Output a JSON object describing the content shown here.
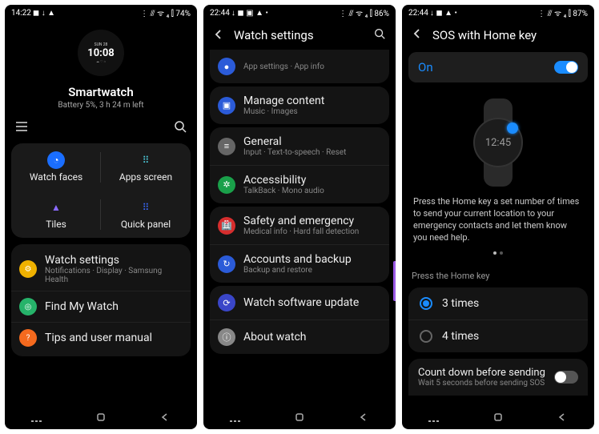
{
  "phone1": {
    "status": {
      "time": "14:22",
      "left_icons": "◼ ↓ ▲",
      "right_icons": "⋮ ⫻ ᯤ ₄ ⫿ 74%"
    },
    "watchface": {
      "date": "SUN 28",
      "time": "10:08",
      "extras": "☁ ♡ ⌂"
    },
    "device_name": "Smartwatch",
    "device_sub": "Battery 5%, 3 h 24 m left",
    "grid": [
      {
        "label": "Watch faces",
        "icon": "◔",
        "bg": "#1a6eff"
      },
      {
        "label": "Apps screen",
        "icon": "⠿",
        "bg": "#000"
      },
      {
        "label": "Tiles",
        "icon": "▲",
        "bg": "#000"
      },
      {
        "label": "Quick panel",
        "icon": "⠿",
        "bg": "#3a3ad6"
      }
    ],
    "settings": [
      {
        "title": "Watch settings",
        "sub": "Notifications · Display · Samsung Health",
        "bg": "#efb100",
        "icon": "⚙"
      },
      {
        "title": "Find My Watch",
        "sub": "",
        "bg": "#26b36a",
        "icon": "◎"
      },
      {
        "title": "Tips and user manual",
        "sub": "",
        "bg": "#f56a1e",
        "icon": "?"
      }
    ]
  },
  "phone2": {
    "status": {
      "time": "22:44",
      "left_icons": "↓ ◼ ▣ ▲ •",
      "right_icons": "⋮ ⫻ ᯤ ₄ ⫿ 86%"
    },
    "header": "Watch settings",
    "groups": [
      [
        {
          "title": "",
          "sub": "App settings · App info",
          "bg": "#2b5bd8",
          "icon": "●"
        }
      ],
      [
        {
          "title": "Manage content",
          "sub": "Music · Images",
          "bg": "#2b5bd8",
          "icon": "▣"
        }
      ],
      [
        {
          "title": "General",
          "sub": "Input · Text-to-speech · Reset",
          "bg": "#666",
          "icon": "≡"
        },
        {
          "title": "Accessibility",
          "sub": "TalkBack · Mono audio",
          "bg": "#1aa04a",
          "icon": "✲"
        }
      ],
      [
        {
          "title": "Safety and emergency",
          "sub": "Medical info · Hard fall detection",
          "bg": "#d62e2e",
          "icon": "🏥"
        },
        {
          "title": "Accounts and backup",
          "sub": "Backup and restore",
          "bg": "#2b5bd8",
          "icon": "↻"
        }
      ],
      [
        {
          "title": "Watch software update",
          "sub": "",
          "bg": "#3a46c8",
          "icon": "⟳"
        },
        {
          "title": "About watch",
          "sub": "",
          "bg": "#888",
          "icon": "ⓘ"
        }
      ]
    ]
  },
  "phone3": {
    "status": {
      "time": "22:44",
      "left_icons": "↓ ◼ ▲ •",
      "right_icons": "⋮ ⫻ ᯤ ₄ ⫿ 87%"
    },
    "header": "SOS with Home key",
    "toggle_label": "On",
    "illus_time": "12:45",
    "description": "Press the Home key a set number of times to send your current location to your emergency contacts and let them know you need help.",
    "section_label": "Press the Home key",
    "options": [
      {
        "label": "3 times",
        "checked": true
      },
      {
        "label": "4 times",
        "checked": false
      }
    ],
    "countdown": {
      "title": "Count down before sending",
      "sub": "Wait 5 seconds before sending SOS"
    }
  }
}
